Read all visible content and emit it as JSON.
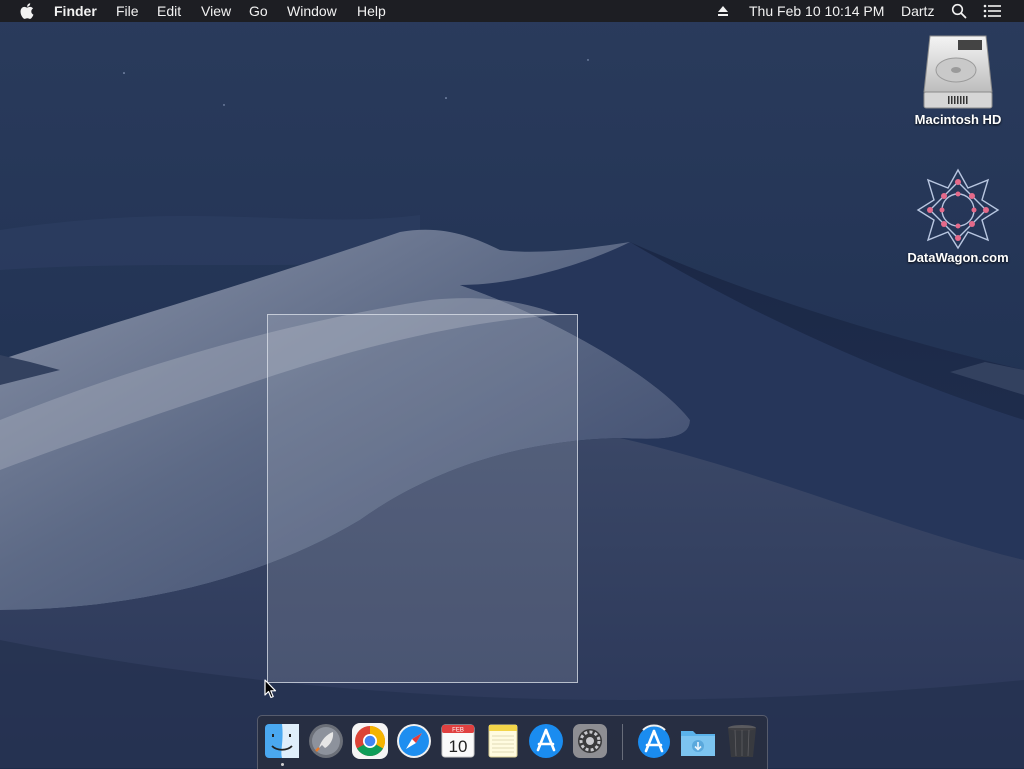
{
  "menubar": {
    "app_name": "Finder",
    "menus": [
      "File",
      "Edit",
      "View",
      "Go",
      "Window",
      "Help"
    ],
    "datetime": "Thu Feb 10  10:14 PM",
    "user": "Dartz",
    "icons": [
      "apple-icon",
      "eject-icon",
      "spotlight-search-icon",
      "notification-center-icon"
    ]
  },
  "desktop": {
    "icons": [
      {
        "label": "Macintosh HD",
        "icon": "hard-drive-icon"
      },
      {
        "label": "DataWagon.com",
        "icon": "datawagon-logo-icon"
      }
    ],
    "selection_rectangle": true
  },
  "dock": {
    "apps": [
      {
        "name": "Finder",
        "icon": "finder-icon",
        "running": true
      },
      {
        "name": "Launchpad",
        "icon": "launchpad-icon"
      },
      {
        "name": "Google Chrome",
        "icon": "chrome-icon"
      },
      {
        "name": "Safari",
        "icon": "safari-icon"
      },
      {
        "name": "Calendar",
        "icon": "calendar-icon",
        "month": "FEB",
        "day": "10"
      },
      {
        "name": "Notes",
        "icon": "notes-icon"
      },
      {
        "name": "App Store",
        "icon": "app-store-icon"
      },
      {
        "name": "System Preferences",
        "icon": "system-preferences-icon"
      },
      {
        "name": "Applications",
        "icon": "applications-stack-icon"
      },
      {
        "name": "Downloads",
        "icon": "downloads-folder-icon"
      },
      {
        "name": "Trash",
        "icon": "trash-icon"
      }
    ]
  },
  "colors": {
    "menubar_bg": "#1c1c1e",
    "sky": "#1e2c4a",
    "selection_border": "#dce1eb"
  }
}
